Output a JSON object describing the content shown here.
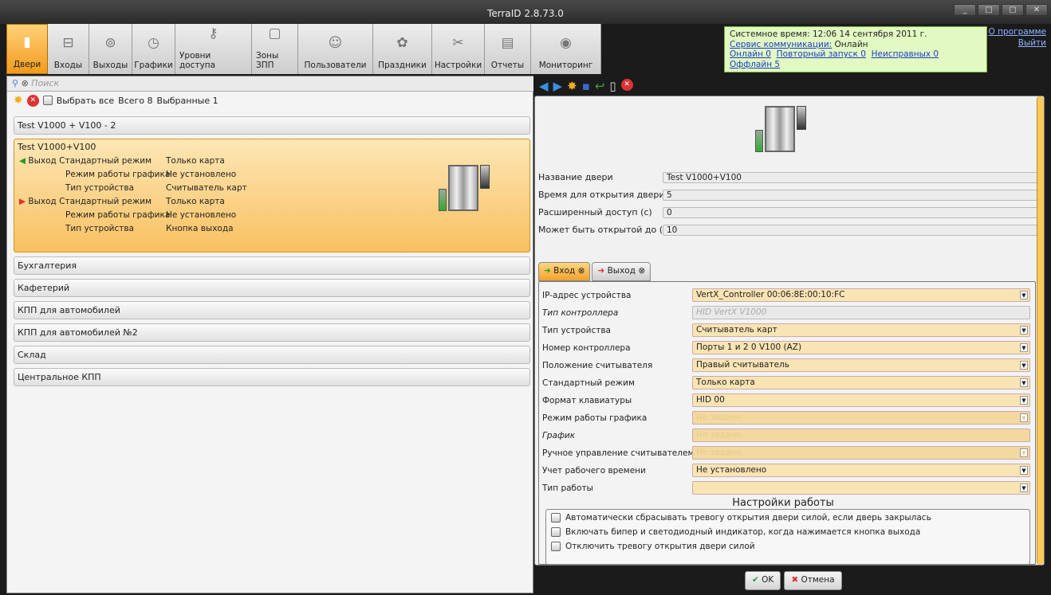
{
  "window": {
    "title": "TerraID 2.8.73.0",
    "buttons": [
      "_",
      "□",
      "▢",
      "✕"
    ]
  },
  "toolbar": [
    {
      "label": "Двери",
      "icon": "door-icon"
    },
    {
      "label": "Входы",
      "icon": "entrance-icon"
    },
    {
      "label": "Выходы",
      "icon": "exit-icon"
    },
    {
      "label": "Графики",
      "icon": "clock-icon"
    },
    {
      "label": "Уровни доступа",
      "icon": "keys-icon"
    },
    {
      "label": "Зоны ЗПП",
      "icon": "zone-icon"
    },
    {
      "label": "Пользователи",
      "icon": "users-icon"
    },
    {
      "label": "Праздники",
      "icon": "holiday-icon"
    },
    {
      "label": "Настройки",
      "icon": "tools-icon"
    },
    {
      "label": "Отчеты",
      "icon": "report-icon"
    },
    {
      "label": "Мониторинг",
      "icon": "eye-icon"
    }
  ],
  "status": {
    "time": "Системное время: 12:06 14 сентября 2011 г.",
    "service_label": "Сервис коммуникации:",
    "service_value": "Онлайн",
    "online": "Онлайн 0",
    "restart": "Повторный запуск 0",
    "faulty": "Неисправных 0",
    "offline": "Оффлайн 5"
  },
  "links": {
    "about": "О программе",
    "exit": "Выйти"
  },
  "left": {
    "search_placeholder": "Поиск",
    "select_all": "Выбрать все",
    "total": "Всего 8",
    "selected": "Выбранные 1",
    "doors_top": "Test V1000 + V100 - 2",
    "selected_door": {
      "name": "Test V1000+V100",
      "lines": [
        {
          "a": "Выход Стандартный режим",
          "b": "Только карта"
        },
        {
          "a": "Режим работы графика",
          "b": "Не установлено"
        },
        {
          "a": "Тип устройства",
          "b": "Считыватель карт"
        },
        {
          "a": "Выход Стандартный режим",
          "b": "Только карта"
        },
        {
          "a": "Режим работы графика",
          "b": "Не установлено"
        },
        {
          "a": "Тип устройства",
          "b": "Кнопка выхода"
        }
      ]
    },
    "doors_bottom": [
      "Бухгалтерия",
      "Кафетерий",
      "КПП для автомобилей",
      "КПП для автомобилей №2",
      "Склад",
      "Центральное КПП"
    ]
  },
  "right": {
    "props": [
      {
        "label": "Название двери",
        "value": "Test V1000+V100"
      },
      {
        "label": "Время для открытия двери (c)",
        "value": "5"
      },
      {
        "label": "Расширенный доступ (с)",
        "value": "0"
      },
      {
        "label": "Может быть открытой до (с)",
        "value": "10"
      }
    ],
    "tabs": [
      "Вход",
      "Выход"
    ],
    "fields": [
      {
        "label": "IP-адрес устройства",
        "value": "VertX_Controller 00:06:8E:00:10:FC"
      },
      {
        "label": "Тип контроллера",
        "value": "HID VertX V1000"
      },
      {
        "label": "Тип устройства",
        "value": "Считыватель карт"
      },
      {
        "label": "Номер контроллера",
        "value": "Порты 1 и 2 0 V100 (AZ)"
      },
      {
        "label": "Положение считывателя",
        "value": "Правый считыватель"
      },
      {
        "label": "Стандартный режим",
        "value": "Только карта"
      },
      {
        "label": "Формат клавиатуры",
        "value": "HID 00"
      },
      {
        "label": "Режим работы графика",
        "value": "Не задано"
      },
      {
        "label": "График",
        "value": "Не задано"
      },
      {
        "label": "Ручное управление считывателем",
        "value": "Не задано"
      },
      {
        "label": "Учет рабочего времени",
        "value": "Не установлено"
      },
      {
        "label": "Тип работы",
        "value": ""
      }
    ],
    "settings_title": "Настройки работы",
    "settings": [
      "Автоматически сбрасывать тревогу открытия двери силой, если дверь закрылась",
      "Включать бипер и светодиодный индикатор, когда нажимается кнопка выхода",
      "Отключить тревогу открытия двери силой"
    ],
    "ok": "OK",
    "cancel": "Отмена"
  }
}
